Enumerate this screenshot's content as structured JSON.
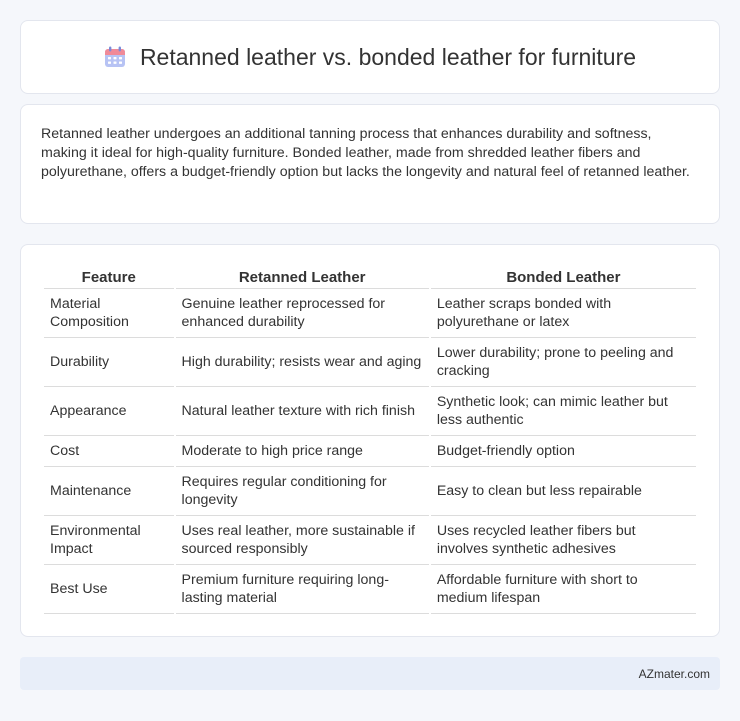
{
  "header": {
    "title": "Retanned leather vs. bonded leather for furniture",
    "icon": "calendar-icon",
    "icon_colors": {
      "top": "#f07a8a",
      "body": "#a9b8f2",
      "rings": "#7a8ad8"
    }
  },
  "intro": {
    "text": "Retanned leather undergoes an additional tanning process that enhances durability and softness, making it ideal for high-quality furniture. Bonded leather, made from shredded leather fibers and polyurethane, offers a budget-friendly option but lacks the longevity and natural feel of retanned leather."
  },
  "table": {
    "headers": [
      "Feature",
      "Retanned Leather",
      "Bonded Leather"
    ],
    "rows": [
      [
        "Material Composition",
        "Genuine leather reprocessed for enhanced durability",
        "Leather scraps bonded with polyurethane or latex"
      ],
      [
        "Durability",
        "High durability; resists wear and aging",
        "Lower durability; prone to peeling and cracking"
      ],
      [
        "Appearance",
        "Natural leather texture with rich finish",
        "Synthetic look; can mimic leather but less authentic"
      ],
      [
        "Cost",
        "Moderate to high price range",
        "Budget-friendly option"
      ],
      [
        "Maintenance",
        "Requires regular conditioning for longevity",
        "Easy to clean but less repairable"
      ],
      [
        "Environmental Impact",
        "Uses real leather, more sustainable if sourced responsibly",
        "Uses recycled leather fibers but involves synthetic adhesives"
      ],
      [
        "Best Use",
        "Premium furniture requiring long-lasting material",
        "Affordable furniture with short to medium lifespan"
      ]
    ]
  },
  "footer": {
    "brand": "AZmater.com"
  }
}
